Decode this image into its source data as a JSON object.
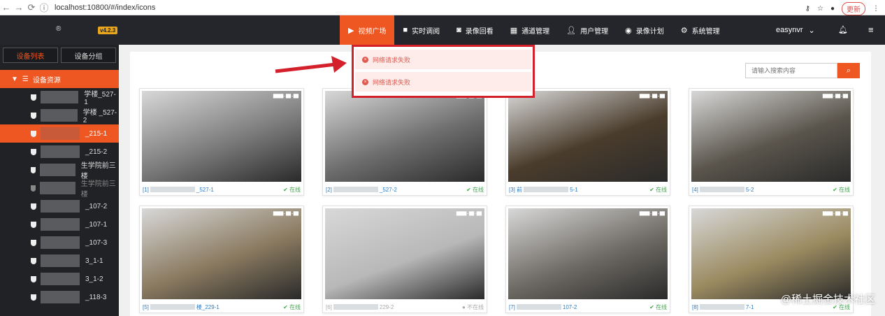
{
  "browser": {
    "url": "localhost:10800/#/index/icons",
    "update_label": "更新"
  },
  "app": {
    "version": "v4.2.3",
    "logo_text": "®"
  },
  "menu": [
    {
      "label": "视频广场",
      "icon": "play-circle-icon",
      "active": true
    },
    {
      "label": "实时调阅",
      "icon": "video-icon"
    },
    {
      "label": "录像回看",
      "icon": "camera-icon"
    },
    {
      "label": "通道管理",
      "icon": "grid-icon"
    },
    {
      "label": "用户管理",
      "icon": "user-icon"
    },
    {
      "label": "录像计划",
      "icon": "film-icon"
    },
    {
      "label": "系统管理",
      "icon": "gear-icon"
    }
  ],
  "user": {
    "name": "easynvr"
  },
  "sidebar": {
    "tabs": [
      "设备列表",
      "设备分组"
    ],
    "root": "设备资源",
    "devices": [
      {
        "label": "学楼_527-1",
        "state": "online"
      },
      {
        "label": "学楼 _527-2",
        "state": "online"
      },
      {
        "label": "_215-1",
        "state": "selected"
      },
      {
        "label": "_215-2",
        "state": "online"
      },
      {
        "label": "生学院前三楼",
        "state": "online"
      },
      {
        "label": "生学院前三楼",
        "state": "offline"
      },
      {
        "label": "_107-2",
        "state": "online"
      },
      {
        "label": "_107-1",
        "state": "online"
      },
      {
        "label": "_107-3",
        "state": "online"
      },
      {
        "label": "3_1-1",
        "state": "online"
      },
      {
        "label": "3_1-2",
        "state": "online"
      },
      {
        "label": "_118-3",
        "state": "online"
      }
    ]
  },
  "search": {
    "placeholder": "请输入搜索内容"
  },
  "toasts": [
    "网络请求失败",
    "网络请求失败"
  ],
  "cards": [
    {
      "index": "[1]",
      "name": "_527-1",
      "status": "在线",
      "online": true,
      "tone": "#7c7c7c"
    },
    {
      "index": "[2]",
      "name": "_527-2",
      "status": "在线",
      "online": true,
      "tone": "#6e6e6e"
    },
    {
      "index": "[3] 前",
      "name": "5-1",
      "status": "在线",
      "online": true,
      "tone": "#4a3c2c"
    },
    {
      "index": "[4]",
      "name": "5-2",
      "status": "在线",
      "online": true,
      "tone": "#5a554c"
    },
    {
      "index": "[5]",
      "name": "楼_229-1",
      "status": "在线",
      "online": true,
      "tone": "#8a7a60"
    },
    {
      "index": "[6]",
      "name": "229-2",
      "status": "不在线",
      "online": false,
      "tone": "#b8b8b8"
    },
    {
      "index": "[7]",
      "name": "107-2",
      "status": "在线",
      "online": true,
      "tone": "#6e6a64"
    },
    {
      "index": "[8]",
      "name": "7-1",
      "status": "在线",
      "online": true,
      "tone": "#9a8a60"
    }
  ],
  "watermark": "@稀土掘金技术社区",
  "colors": {
    "accent": "#ee5622",
    "topbar": "#24262b",
    "sidebar": "#202226",
    "online": "#3fa84a",
    "error": "#d3202b"
  }
}
